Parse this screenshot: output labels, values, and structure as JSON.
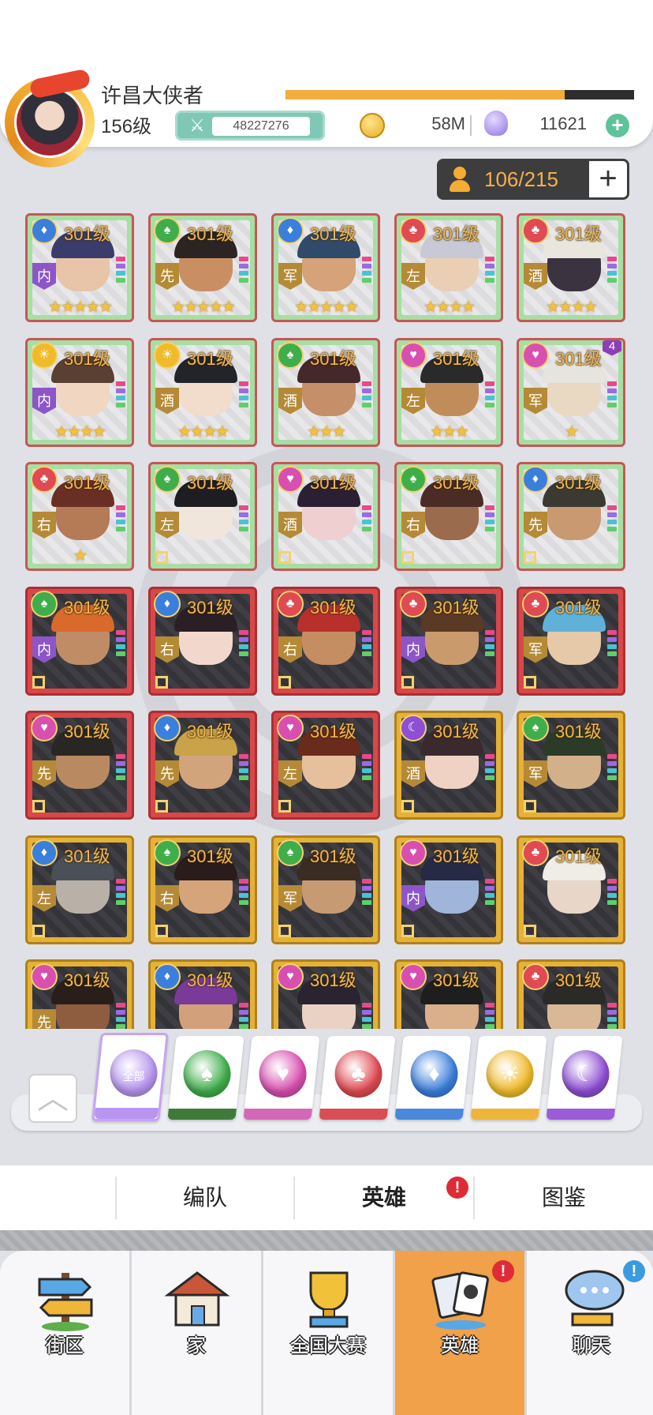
{
  "player": {
    "name": "许昌大侠者",
    "level": "156级",
    "power": "48227276",
    "xp_fraction": 0.8
  },
  "currency": {
    "gold": "58M",
    "gems": "11621"
  },
  "hero_count": "106/215",
  "heroes": [
    {
      "level": "301级",
      "suit": "diamond",
      "role": "内",
      "stars": "★★★★★",
      "rarity": "green",
      "hair": "#3a3c6b",
      "skin": "#e8c4a8"
    },
    {
      "level": "301级",
      "suit": "spade",
      "role": "先",
      "stars": "★★★★★",
      "rarity": "green",
      "hair": "#2b2422",
      "skin": "#c98f62"
    },
    {
      "level": "301级",
      "suit": "diamond",
      "role": "军",
      "stars": "★★★★★",
      "rarity": "green",
      "hair": "#314a6a",
      "skin": "#d5a27a"
    },
    {
      "level": "301级",
      "suit": "club",
      "role": "左",
      "stars": "★★★★",
      "rarity": "green",
      "hair": "#c7c9d4",
      "skin": "#eacfb4"
    },
    {
      "level": "301级",
      "suit": "club",
      "role": "酒",
      "stars": "★★★★",
      "rarity": "green",
      "hair": "#e9e6de",
      "skin": "#3c3340"
    },
    {
      "level": "301级",
      "suit": "sun",
      "role": "内",
      "stars": "★★★★",
      "rarity": "green",
      "hair": "#5a3f33",
      "skin": "#f1d6c2"
    },
    {
      "level": "301级",
      "suit": "sun",
      "role": "酒",
      "stars": "★★★★",
      "rarity": "green",
      "hair": "#23232a",
      "skin": "#f2dccc"
    },
    {
      "level": "301级",
      "suit": "spade",
      "role": "酒",
      "stars": "★★★",
      "rarity": "green",
      "hair": "#44282a",
      "skin": "#c58f6a"
    },
    {
      "level": "301级",
      "suit": "heart",
      "role": "左",
      "stars": "★★★",
      "rarity": "green",
      "hair": "#2a2a2a",
      "skin": "#c08d5a"
    },
    {
      "level": "301级",
      "suit": "heart",
      "role": "军",
      "stars": "★",
      "rarity": "green",
      "hair": "#e6e4df",
      "skin": "#e9d8c2",
      "badge": "4"
    },
    {
      "level": "301级",
      "suit": "club",
      "role": "右",
      "stars": "★",
      "rarity": "green",
      "hair": "#6a2f24",
      "skin": "#b57a56"
    },
    {
      "level": "301级",
      "suit": "spade",
      "role": "左",
      "stars": "",
      "rarity": "green",
      "hair": "#1e1e22",
      "skin": "#f0e6dc"
    },
    {
      "level": "301级",
      "suit": "heart",
      "role": "酒",
      "stars": "",
      "rarity": "green",
      "hair": "#2b1f34",
      "skin": "#efcfcf"
    },
    {
      "level": "301级",
      "suit": "spade",
      "role": "右",
      "stars": "",
      "rarity": "green",
      "hair": "#4a2c24",
      "skin": "#9a6b4c"
    },
    {
      "level": "301级",
      "suit": "diamond",
      "role": "先",
      "stars": "",
      "rarity": "green",
      "hair": "#3a3a32",
      "skin": "#c99a72"
    },
    {
      "level": "301级",
      "suit": "spade",
      "role": "内",
      "stars": "",
      "rarity": "red",
      "hair": "#d86a2c",
      "skin": "#c08c66"
    },
    {
      "level": "301级",
      "suit": "diamond",
      "role": "右",
      "stars": "",
      "rarity": "red",
      "hair": "#2a1f24",
      "skin": "#f2d8cc"
    },
    {
      "level": "301级",
      "suit": "club",
      "role": "右",
      "stars": "",
      "rarity": "red",
      "hair": "#b8302c",
      "skin": "#c58d62"
    },
    {
      "level": "301级",
      "suit": "club",
      "role": "内",
      "stars": "",
      "rarity": "red",
      "hair": "#5a3a24",
      "skin": "#c99a6c"
    },
    {
      "level": "301级",
      "suit": "club",
      "role": "军",
      "stars": "",
      "rarity": "red",
      "hair": "#5fb1d9",
      "skin": "#e6c9a8"
    },
    {
      "level": "301级",
      "suit": "heart",
      "role": "先",
      "stars": "",
      "rarity": "red",
      "hair": "#2a2624",
      "skin": "#b98a62"
    },
    {
      "level": "301级",
      "suit": "diamond",
      "role": "先",
      "stars": "",
      "rarity": "red",
      "hair": "#c9a24a",
      "skin": "#d2a47c"
    },
    {
      "level": "301级",
      "suit": "heart",
      "role": "左",
      "stars": "",
      "rarity": "red",
      "hair": "#6a2a1c",
      "skin": "#e6c09c"
    },
    {
      "level": "301级",
      "suit": "moon",
      "role": "酒",
      "stars": "",
      "rarity": "gold",
      "hair": "#3a2a2e",
      "skin": "#f0d2c4"
    },
    {
      "level": "301级",
      "suit": "spade",
      "role": "军",
      "stars": "",
      "rarity": "gold",
      "hair": "#2c3a28",
      "skin": "#d2b08a"
    },
    {
      "level": "301级",
      "suit": "diamond",
      "role": "左",
      "stars": "",
      "rarity": "gold",
      "hair": "#4a4f58",
      "skin": "#b9b1a8"
    },
    {
      "level": "301级",
      "suit": "spade",
      "role": "右",
      "stars": "",
      "rarity": "gold",
      "hair": "#2a1c1a",
      "skin": "#d6a47a"
    },
    {
      "level": "301级",
      "suit": "spade",
      "role": "军",
      "stars": "",
      "rarity": "gold",
      "hair": "#3a2c22",
      "skin": "#c69a72"
    },
    {
      "level": "301级",
      "suit": "heart",
      "role": "内",
      "stars": "",
      "rarity": "gold",
      "hair": "#262a44",
      "skin": "#9fb5d9"
    },
    {
      "level": "301级",
      "suit": "club",
      "role": "",
      "stars": "",
      "rarity": "gold",
      "hair": "#f0ece6",
      "skin": "#e8d6c8"
    },
    {
      "level": "301级",
      "suit": "heart",
      "role": "先",
      "stars": "",
      "rarity": "gold",
      "hair": "#2a1e1a",
      "skin": "#8e5c3e"
    },
    {
      "level": "301级",
      "suit": "diamond",
      "role": "",
      "stars": "",
      "rarity": "gold",
      "hair": "#7a3a9a",
      "skin": "#d2a07a"
    },
    {
      "level": "301级",
      "suit": "heart",
      "role": "",
      "stars": "",
      "rarity": "gold",
      "hair": "#2a2430",
      "skin": "#e9d2c4"
    },
    {
      "level": "301级",
      "suit": "heart",
      "role": "",
      "stars": "",
      "rarity": "gold",
      "hair": "#1e1e1e",
      "skin": "#d9b08a"
    },
    {
      "level": "301级",
      "suit": "club",
      "role": "",
      "stars": "",
      "rarity": "gold",
      "hair": "#2a2a26",
      "skin": "#d8b896"
    }
  ],
  "filters": [
    {
      "id": "all",
      "label": "全部",
      "color": "#b896f0",
      "stripe": "#b896f0"
    },
    {
      "id": "spade",
      "label": "",
      "color": "#3fae4a",
      "stripe": "#3e7b3a"
    },
    {
      "id": "heart",
      "label": "",
      "color": "#d94fb0",
      "stripe": "#d468b8"
    },
    {
      "id": "club",
      "label": "",
      "color": "#e04a52",
      "stripe": "#d94d55"
    },
    {
      "id": "diamond",
      "label": "",
      "color": "#3b7fdc",
      "stripe": "#4a88dc"
    },
    {
      "id": "sun",
      "label": "",
      "color": "#f0bb2a",
      "stripe": "#efb53a"
    },
    {
      "id": "moon",
      "label": "",
      "color": "#8e4fd4",
      "stripe": "#9c5bd8"
    }
  ],
  "subtabs": [
    "编队",
    "英雄",
    "图鉴"
  ],
  "nav": [
    "街区",
    "家",
    "全国大赛",
    "英雄",
    "聊天"
  ],
  "colors": {
    "accent": "#f0a14a",
    "alert_red": "#e02a36",
    "alert_blue": "#3a9be0"
  }
}
